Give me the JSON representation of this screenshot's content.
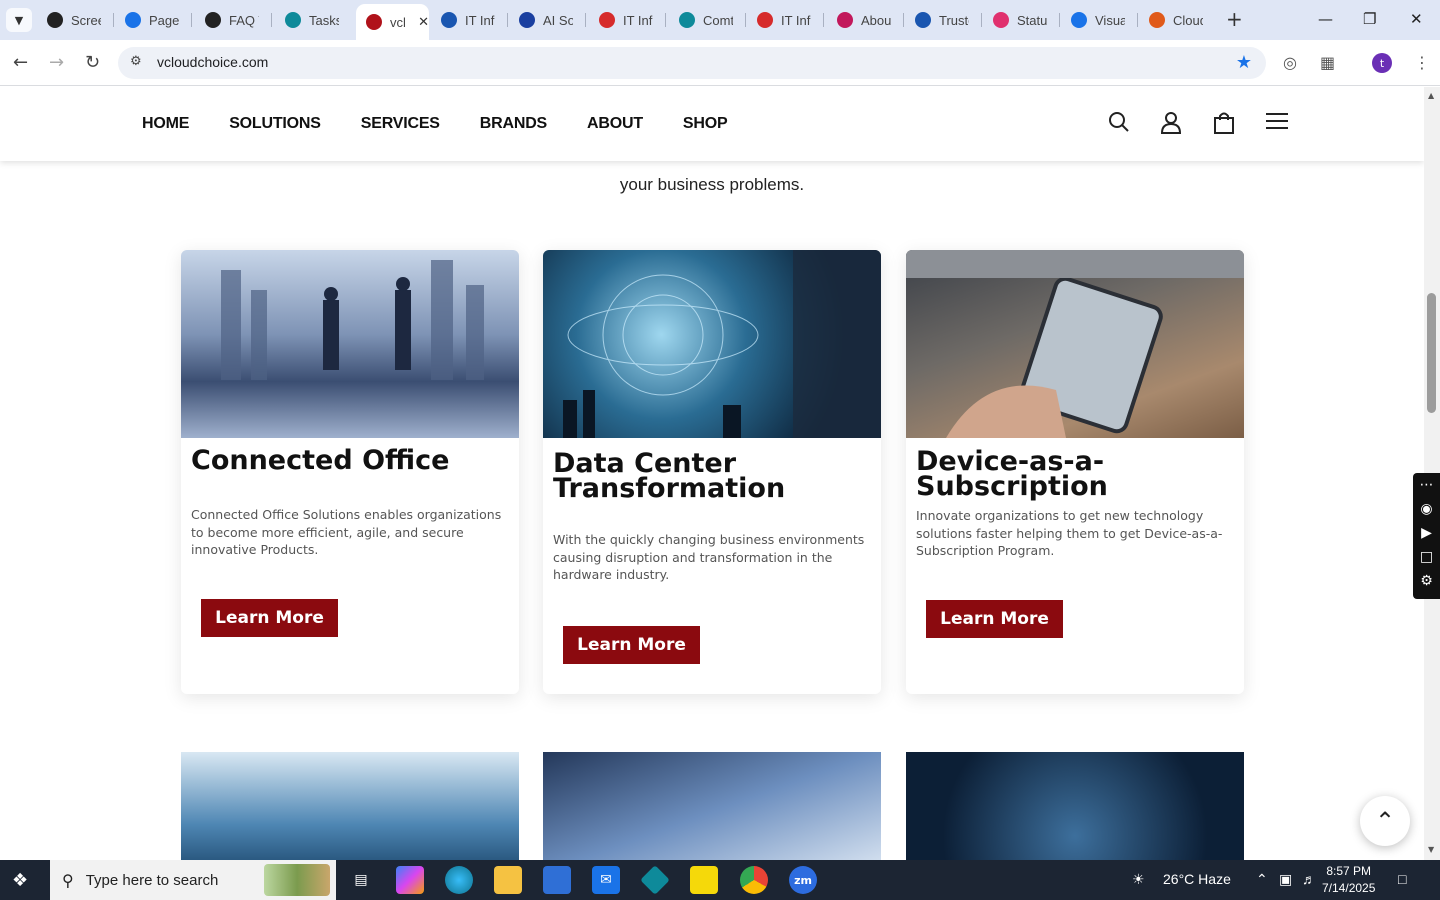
{
  "browser": {
    "tabs": [
      {
        "label": "Screen",
        "color": "#222"
      },
      {
        "label": "PageSpeed",
        "color": "#1a73e8"
      },
      {
        "label": "FAQ Tips",
        "color": "#222"
      },
      {
        "label": "Tasks",
        "color": "#0e8a9a"
      },
      {
        "label": "vcloudchoice",
        "color": "#b0121a"
      },
      {
        "label": "IT Infrastructure",
        "color": "#1a56b0"
      },
      {
        "label": "AI Software",
        "color": "#1a3fa0"
      },
      {
        "label": "IT Infrastructure",
        "color": "#d62b2b"
      },
      {
        "label": "Comtrade",
        "color": "#0e8a9a"
      },
      {
        "label": "IT Infrastructure",
        "color": "#d62b2b"
      },
      {
        "label": "About",
        "color": "#c2185b"
      },
      {
        "label": "Trusted",
        "color": "#1a56b0"
      },
      {
        "label": "Status",
        "color": "#e0306e"
      },
      {
        "label": "Visual",
        "color": "#1a73e8"
      },
      {
        "label": "Cloud",
        "color": "#e05a1a"
      }
    ],
    "url": "vcloudchoice.com",
    "profile_initial": "t"
  },
  "site": {
    "nav": [
      "HOME",
      "SOLUTIONS",
      "SERVICES",
      "BRANDS",
      "ABOUT",
      "SHOP"
    ],
    "intro_text": "your business problems.",
    "cards": [
      {
        "title": "Connected Office",
        "desc": "Connected Office Solutions enables organizations to become more efficient, agile, and secure innovative Products.",
        "button": "Learn More"
      },
      {
        "title": "Data Center Transformation",
        "desc": "With the quickly changing business environments causing disruption and transformation in the hardware industry.",
        "button": "Learn More"
      },
      {
        "title": "Device-as-a-Subscription",
        "desc": "Innovate organizations to get new technology solutions faster helping them to get Device-as-a-Subscription Program.",
        "button": "Learn More"
      }
    ]
  },
  "taskbar": {
    "search_placeholder": "Type here to search",
    "weather": "26°C  Haze",
    "time": "8:57 PM",
    "date": "7/14/2025"
  }
}
